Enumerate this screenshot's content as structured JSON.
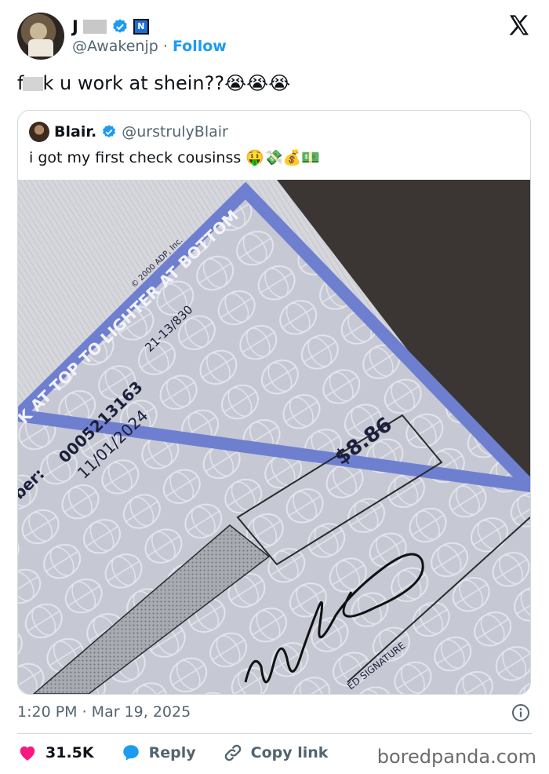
{
  "author": {
    "name_prefix": "J",
    "handle": "@Awakenjp",
    "follow_label": "Follow",
    "separator": "·"
  },
  "tweet": {
    "text_pre": "f",
    "text_post": "k u work at shein??😭😭😭"
  },
  "quoted": {
    "name": "Blair.",
    "handle": "@urstrulyBlair",
    "text": "i got my first check cousinss 🤑💸💰💵",
    "check": {
      "amount": "$8.86",
      "number_label": "ber:",
      "number": "0005213163",
      "date": "11/01/2024",
      "routing": "21-13/830",
      "banner": "K AT TOP TO LIGHTER AT BOTTOM",
      "copyright": "© 2000 ADP, Inc.",
      "signature_label": "ED SIGNATURE"
    }
  },
  "meta": {
    "time": "1:20 PM · Mar 19, 2025"
  },
  "actions": {
    "likes": "31.5K",
    "reply": "Reply",
    "copy_link": "Copy link"
  },
  "watermark": "boredpanda.com",
  "colors": {
    "accent": "#1d9bf0",
    "like": "#f91880",
    "check_border": "#6f7fd0"
  }
}
